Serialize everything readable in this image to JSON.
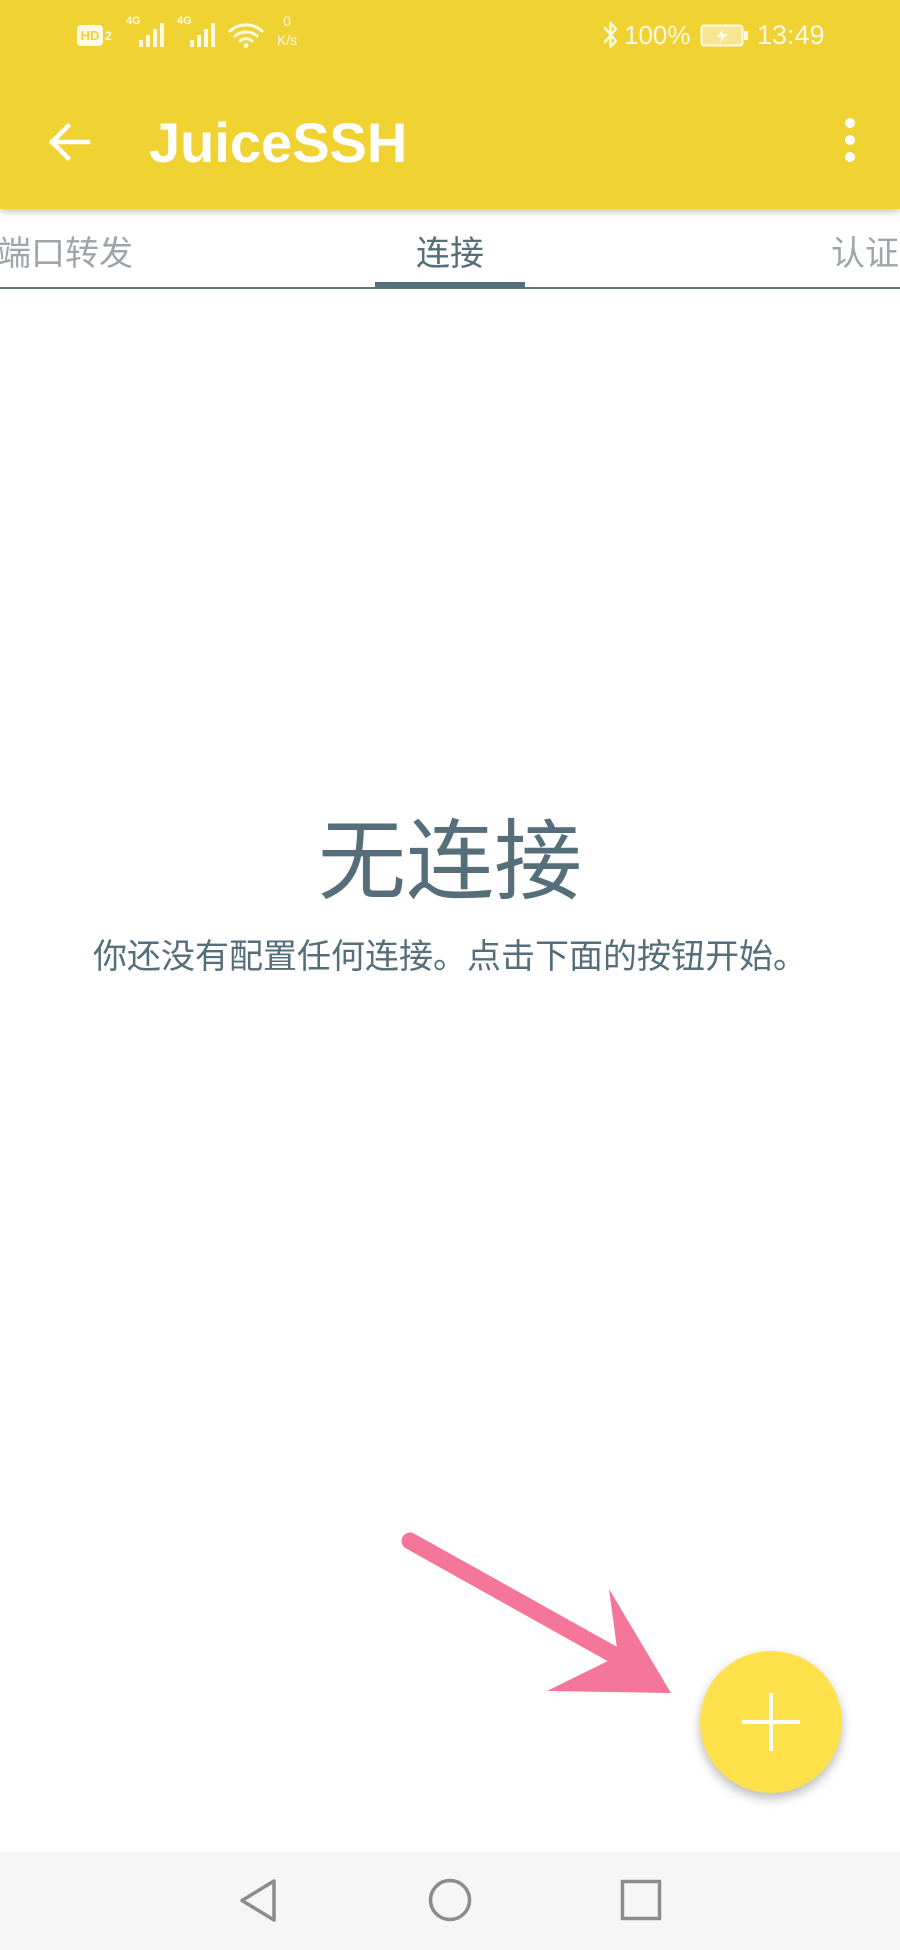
{
  "status_bar": {
    "hd_label": "HD",
    "sim_label": "2",
    "network_1": "4G",
    "network_2": "4G",
    "speed_value": "0",
    "speed_unit": "K/s",
    "battery_percent": "100%",
    "time": "13:49",
    "icons": [
      "hd-icon",
      "signal-icon",
      "signal-icon",
      "wifi-icon",
      "bluetooth-icon",
      "battery-charging-icon"
    ]
  },
  "app_bar": {
    "title": "JuiceSSH",
    "back_icon": "arrow-left-icon",
    "menu_icon": "more-vertical-icon"
  },
  "tabs": [
    {
      "label": "端口转发",
      "selected": false
    },
    {
      "label": "连接",
      "selected": true
    },
    {
      "label": "认证",
      "selected": false
    }
  ],
  "empty_state": {
    "title": "无连接",
    "message": "你还没有配置任何连接。点击下面的按钮开始。"
  },
  "annotation": {
    "icon": "pointer-arrow-icon"
  },
  "fab": {
    "icon": "plus-icon"
  },
  "nav_bar": {
    "icons": [
      "nav-back-icon",
      "nav-home-icon",
      "nav-recents-icon"
    ]
  },
  "colors": {
    "app_bar": "#F1D233",
    "fab": "#FFE14B",
    "text_main": "#546E7A",
    "tab_muted": "#9EA6AA",
    "arrow": "#F4769A",
    "nav_bg": "#F6F6F6",
    "nav_icon": "#8C8C8C"
  }
}
